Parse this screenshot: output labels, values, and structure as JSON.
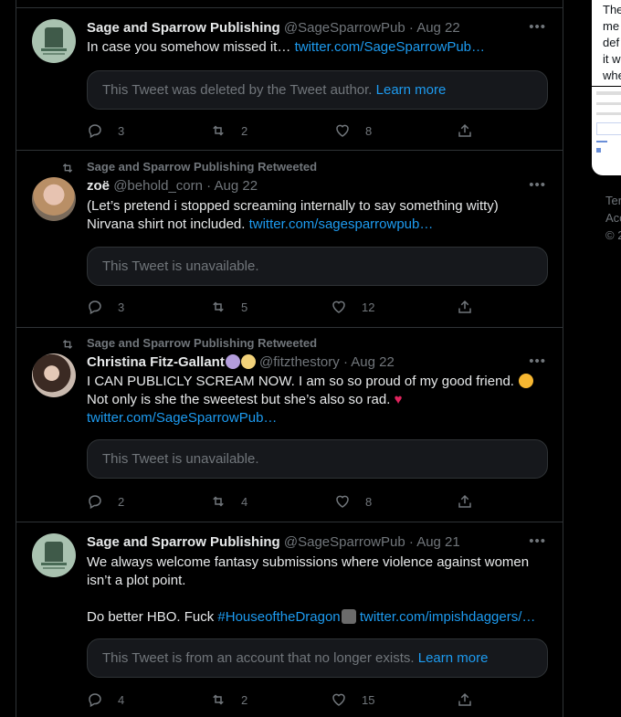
{
  "tweets": [
    {
      "name": "Sage and Sparrow Publishing",
      "handle": "@SageSparrowPub",
      "date": "· Aug 22",
      "text_lines": [
        "In case you somehow missed it… "
      ],
      "link": "twitter.com/SageSparrowPub…",
      "quote_text": "This Tweet was deleted by the Tweet author.",
      "quote_link": "Learn more",
      "counts": {
        "reply": "3",
        "retweet": "2",
        "like": "8"
      }
    },
    {
      "retweeted_by": "Sage and Sparrow Publishing Retweeted",
      "name": "zoë",
      "handle": "@behold_corn",
      "date": "· Aug 22",
      "text_line1": "(Let’s pretend i stopped screaming internally to say something witty)",
      "text_line2": "Nirvana shirt not included. ",
      "link": "twitter.com/sagesparrowpub…",
      "quote_text": "This Tweet is unavailable.",
      "counts": {
        "reply": "3",
        "retweet": "5",
        "like": "12"
      }
    },
    {
      "retweeted_by": "Sage and Sparrow Publishing Retweeted",
      "name": "Christina Fitz-Gallant",
      "handle": "@fitzthestory",
      "date": "· Aug 22",
      "text_line1": "I CAN PUBLICLY SCREAM NOW. I am so so proud of my good friend. ",
      "text_line2": "Not only is she the sweetest but she’s also so rad. ",
      "link": "twitter.com/SageSparrowPub…",
      "quote_text": "This Tweet is unavailable.",
      "counts": {
        "reply": "2",
        "retweet": "4",
        "like": "8"
      }
    },
    {
      "name": "Sage and Sparrow Publishing",
      "handle": "@SageSparrowPub",
      "date": "· Aug 21",
      "text_line1": "We always welcome fantasy submissions where violence against women",
      "text_line2": "isn’t a plot point.",
      "text_line3": "Do better HBO. Fuck ",
      "hashtag": "#HouseoftheDragon",
      "link": "twitter.com/impishdaggers/…",
      "quote_text": "This Tweet is from an account that no longer exists.",
      "quote_link": "Learn more",
      "counts": {
        "reply": "4",
        "retweet": "2",
        "like": "15"
      }
    }
  ],
  "sidebar": {
    "card_lines": [
      "The",
      "me",
      "def",
      "it w",
      "whe"
    ],
    "footer_lines": [
      "Ter",
      "Acc",
      "© 2"
    ]
  },
  "colors": {
    "background": "#000000",
    "link": "#1d9bf0",
    "muted": "#71767b",
    "border": "#2f3336"
  }
}
